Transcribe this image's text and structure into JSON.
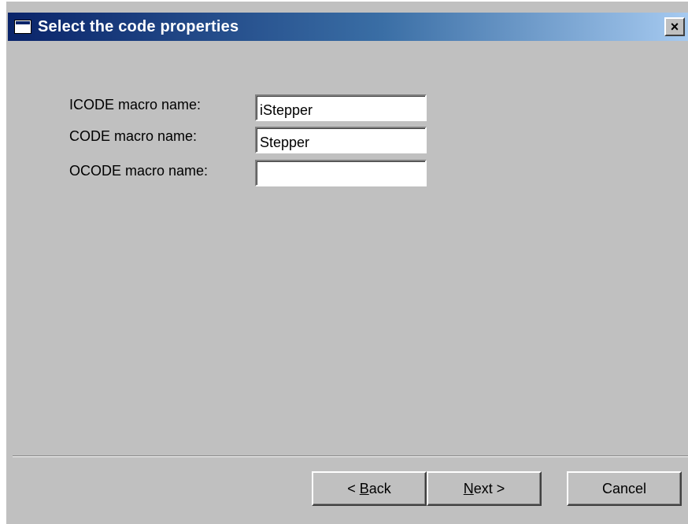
{
  "window": {
    "title": "Select the code properties",
    "close_glyph": "×",
    "title_icon": "window-icon"
  },
  "form": {
    "fields": [
      {
        "label": "ICODE macro name:",
        "value": "iStepper"
      },
      {
        "label": "CODE macro name:",
        "value": "Stepper"
      },
      {
        "label": "OCODE macro name:",
        "value": ""
      }
    ]
  },
  "buttons": {
    "back_prefix": "< ",
    "back_mnemonic": "B",
    "back_rest": "ack",
    "next_mnemonic": "N",
    "next_rest": "ext >",
    "cancel": "Cancel"
  },
  "colors": {
    "dialog_face": "#c0c0c0",
    "titlebar_start": "#0a246a",
    "titlebar_end": "#a6caf0",
    "title_text": "#ffffff"
  }
}
